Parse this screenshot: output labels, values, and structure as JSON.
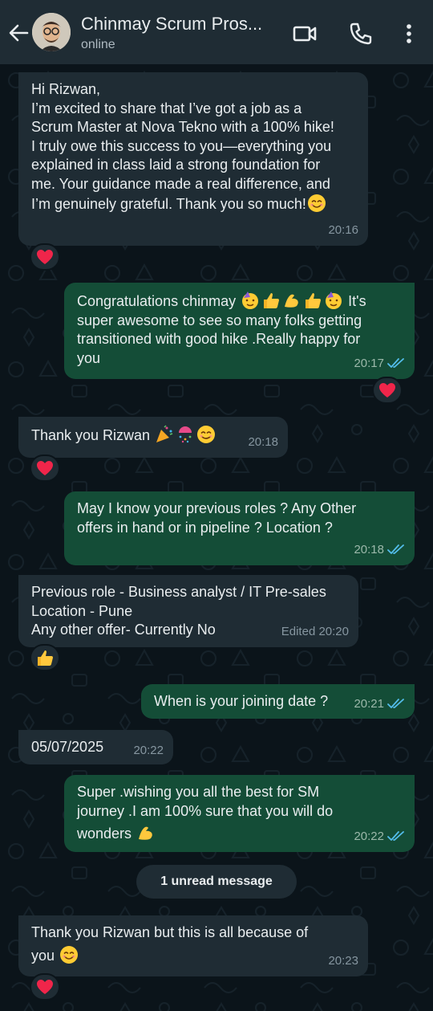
{
  "header": {
    "title": "Chinmay Scrum Pros...",
    "status": "online",
    "icons": [
      "back-arrow-icon",
      "video-call-icon",
      "voice-call-icon",
      "more-options-icon"
    ]
  },
  "colors": {
    "background": "#0b141a",
    "incoming_bubble": "#1f2c34",
    "outgoing_bubble": "#144d37",
    "read_receipt": "#53bdeb",
    "heart": "#f0254a"
  },
  "messages": [
    {
      "direction": "incoming",
      "lines": [
        "Hi Rizwan,",
        "I’m excited to share that I’ve got a job as a",
        "Scrum Master at Nova Tekno with a 100% hike!",
        "I truly owe this success to you—everything you",
        "explained in class laid a strong foundation for",
        "me. Your guidance made a real difference, and",
        "I’m genuinely grateful. Thank you so much!"
      ],
      "emoji": [
        "smiling-face"
      ],
      "time": "20:16",
      "reaction": "red-heart"
    },
    {
      "direction": "outgoing",
      "lines": [
        "Congratulations chinmay",
        "It's",
        "super awesome to see so many folks getting",
        "transitioned with good hike .Really happy for",
        "you"
      ],
      "emoji": [
        "partying-face",
        "thumbs-up",
        "flexed-biceps",
        "thumbs-up",
        "partying-face"
      ],
      "time": "20:17",
      "read": true,
      "reaction": "red-heart"
    },
    {
      "direction": "incoming",
      "lines": [
        "Thank you Rizwan"
      ],
      "emoji": [
        "party-popper",
        "confetti-ball",
        "smiling-face"
      ],
      "time": "20:18",
      "reaction": "red-heart"
    },
    {
      "direction": "outgoing",
      "lines": [
        "May I know your previous roles ? Any Other",
        "offers in hand or in pipeline ? Location ?"
      ],
      "time": "20:18",
      "read": true
    },
    {
      "direction": "incoming",
      "lines": [
        "Previous role - Business analyst / IT Pre-sales",
        "Location - Pune",
        "Any other offer- Currently No"
      ],
      "time": "Edited 20:20",
      "reaction": "thumbs-up"
    },
    {
      "direction": "outgoing",
      "lines": [
        "When is your joining date ?"
      ],
      "time": "20:21",
      "read": true
    },
    {
      "direction": "incoming",
      "lines": [
        "05/07/2025"
      ],
      "time": "20:22"
    },
    {
      "direction": "outgoing",
      "lines": [
        "Super .wishing you all the best for SM",
        "journey .I am 100% sure that you will do",
        "wonders"
      ],
      "emoji": [
        "flexed-biceps"
      ],
      "time": "20:22",
      "read": true
    },
    {
      "direction": "incoming",
      "lines": [
        "Thank you Rizwan but this is all because of",
        "you"
      ],
      "emoji": [
        "smiling-face"
      ],
      "time": "20:23",
      "reaction": "red-heart"
    }
  ],
  "unread_label": "1 unread message"
}
